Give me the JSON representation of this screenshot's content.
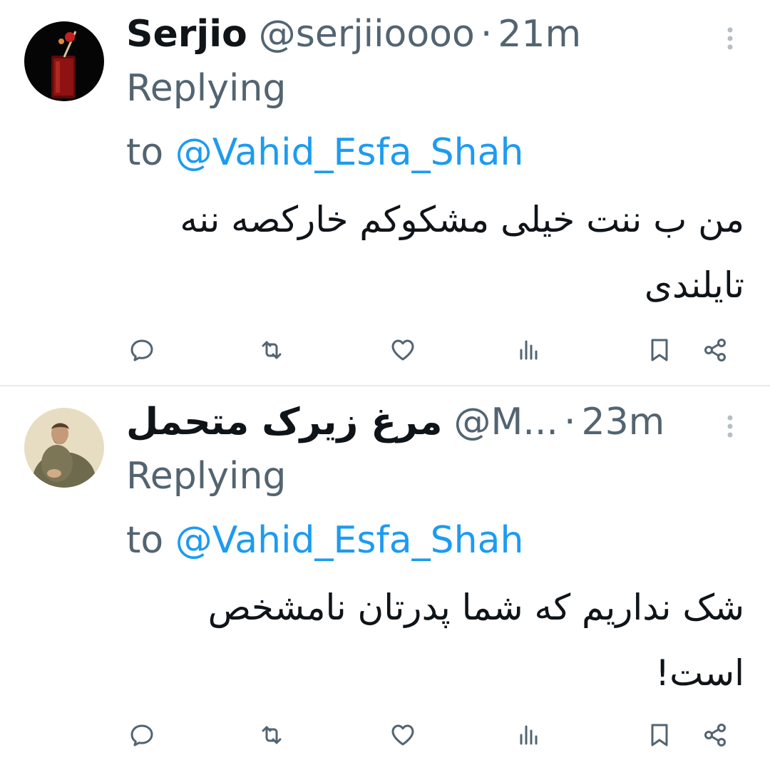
{
  "colors": {
    "text_primary": "#0f1419",
    "text_secondary": "#536471",
    "mention": "#1d9bf0",
    "divider": "#e7e9eb"
  },
  "tweets": [
    {
      "display_name": "Serjio",
      "handle": "@serjiioooo",
      "separator": "·",
      "time": "21m",
      "replying_line1": "Replying",
      "replying_to": "to",
      "replying_mention": "@Vahid_Esfa_Shah",
      "body": "من ب ننت خیلی مشکوکم خارکصه ننه تایلندی",
      "avatar_icon": "drink-glass-avatar",
      "actions": [
        "reply-icon",
        "retweet-icon",
        "like-icon",
        "views-icon",
        "bookmark-icon",
        "share-icon"
      ]
    },
    {
      "display_name": "مرغ زیرک متحمل",
      "handle": "@M...",
      "separator": "·",
      "time": "23m",
      "replying_line1": "Replying",
      "replying_to": "to",
      "replying_mention": "@Vahid_Esfa_Shah",
      "body": "شک نداریم که شما پدرتان نامشخص است!",
      "avatar_icon": "portrait-painting-avatar",
      "actions": [
        "reply-icon",
        "retweet-icon",
        "like-icon",
        "views-icon",
        "bookmark-icon",
        "share-icon"
      ]
    }
  ]
}
